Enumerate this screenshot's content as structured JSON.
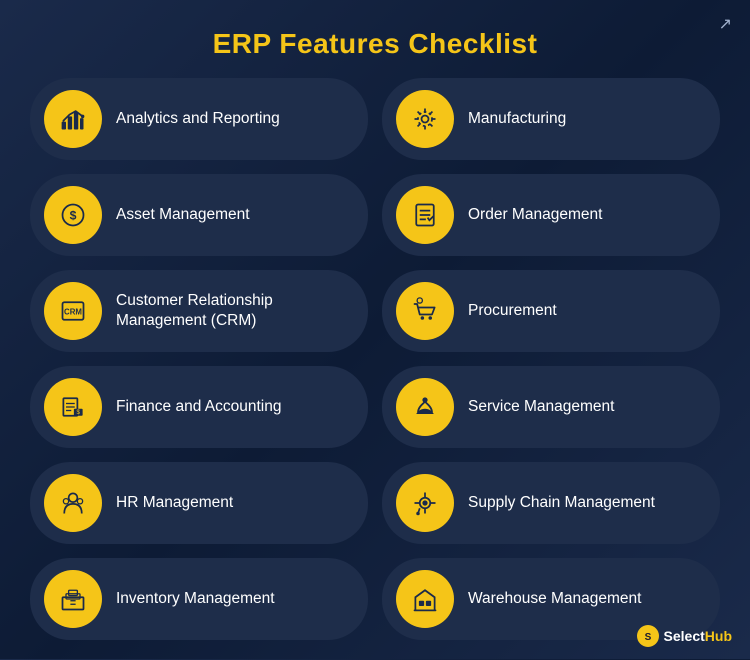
{
  "title": "ERP Features Checklist",
  "items": [
    {
      "id": "analytics",
      "label": "Analytics and Reporting",
      "icon": "📊",
      "col": 0
    },
    {
      "id": "manufacturing",
      "label": "Manufacturing",
      "icon": "⚙️",
      "col": 1
    },
    {
      "id": "asset",
      "label": "Asset Management",
      "icon": "💰",
      "col": 0
    },
    {
      "id": "order",
      "label": "Order Management",
      "icon": "📋",
      "col": 1
    },
    {
      "id": "crm",
      "label": "Customer Relationship Management (CRM)",
      "icon": "🗂️",
      "col": 0
    },
    {
      "id": "procurement",
      "label": "Procurement",
      "icon": "🛒",
      "col": 1
    },
    {
      "id": "finance",
      "label": "Finance and Accounting",
      "icon": "🧾",
      "col": 0
    },
    {
      "id": "service",
      "label": "Service Management",
      "icon": "🤝",
      "col": 1
    },
    {
      "id": "hr",
      "label": "HR Management",
      "icon": "👥",
      "col": 0
    },
    {
      "id": "supply",
      "label": "Supply Chain Management",
      "icon": "🔧",
      "col": 1
    },
    {
      "id": "inventory",
      "label": "Inventory Management",
      "icon": "🏭",
      "col": 0
    },
    {
      "id": "warehouse",
      "label": "Warehouse Management",
      "icon": "🏢",
      "col": 1
    }
  ],
  "brand": {
    "select": "Select",
    "hub": "Hub"
  }
}
